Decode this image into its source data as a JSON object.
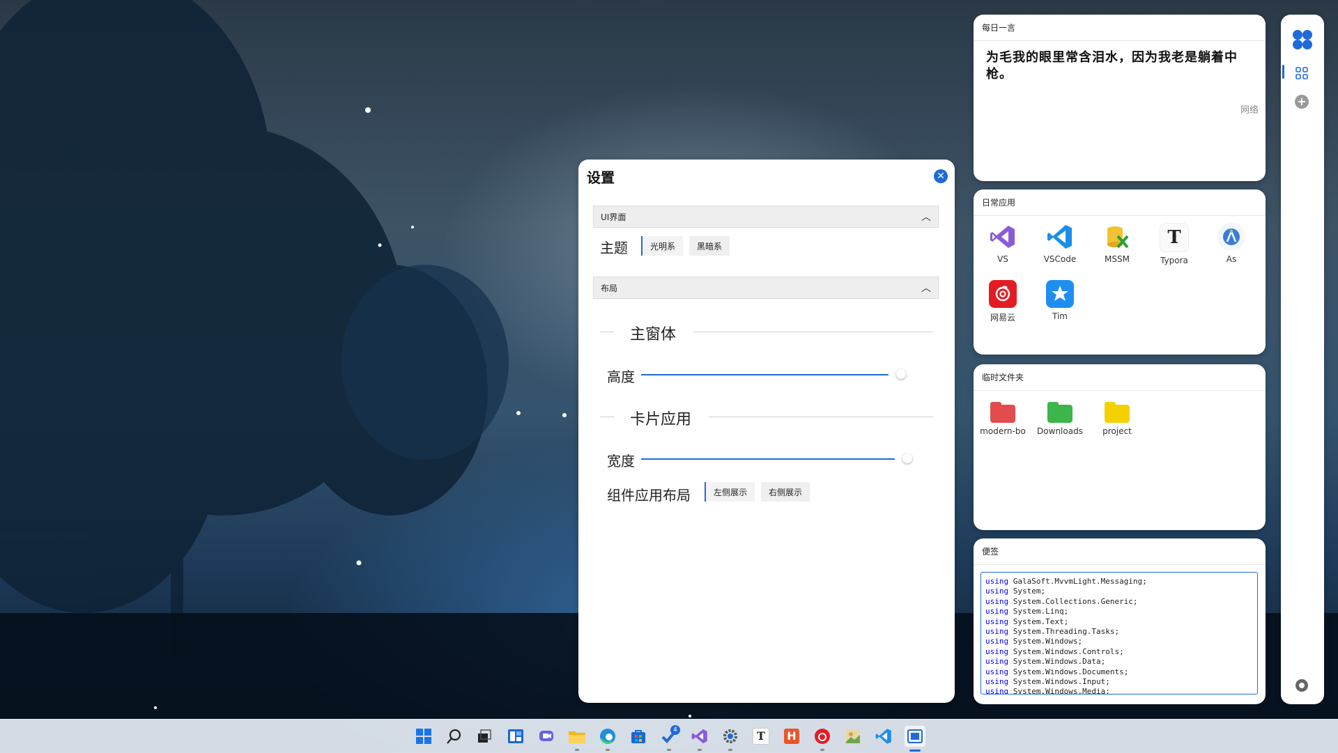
{
  "settings": {
    "title": "设置",
    "ui_section": "UI界面",
    "theme_label": "主题",
    "theme_options": [
      "光明系",
      "黑暗系"
    ],
    "layout_section": "布局",
    "main_window_title": "主窗体",
    "height_label": "高度",
    "height_value_pct": 97,
    "card_app_title": "卡片应用",
    "width_label": "宽度",
    "width_value_pct": 98,
    "component_layout_label": "组件应用布局",
    "layout_options": [
      "左侧展示",
      "右侧展示"
    ]
  },
  "quote_card": {
    "header": "每日一言",
    "text": "为毛我的眼里常含泪水，因为我老是躺着中枪。",
    "source": "网络"
  },
  "apps_card": {
    "header": "日常应用",
    "apps": [
      {
        "label": "VS",
        "icon": "visual-studio-icon"
      },
      {
        "label": "VSCode",
        "icon": "vscode-icon"
      },
      {
        "label": "MSSM",
        "icon": "mssm-icon"
      },
      {
        "label": "Typora",
        "icon": "typora-icon"
      },
      {
        "label": "As",
        "icon": "android-studio-icon"
      },
      {
        "label": "网易云",
        "icon": "netease-music-icon"
      },
      {
        "label": "Tim",
        "icon": "tim-icon"
      }
    ]
  },
  "folder_card": {
    "header": "临时文件夹",
    "folders": [
      {
        "label": "modern-bo",
        "color": "#e24c4c"
      },
      {
        "label": "Downloads",
        "color": "#3cb54a"
      },
      {
        "label": "project",
        "color": "#f5d000"
      }
    ]
  },
  "notes_card": {
    "header": "便签",
    "lines": [
      {
        "kw": "using",
        "text": " GalaSoft.MvvmLight.Messaging;"
      },
      {
        "kw": "using",
        "text": " System;"
      },
      {
        "kw": "using",
        "text": " System.Collections.Generic;"
      },
      {
        "kw": "using",
        "text": " System.Linq;"
      },
      {
        "kw": "using",
        "text": " System.Text;"
      },
      {
        "kw": "using",
        "text": " System.Threading.Tasks;"
      },
      {
        "kw": "using",
        "text": " System.Windows;"
      },
      {
        "kw": "using",
        "text": " System.Windows.Controls;"
      },
      {
        "kw": "using",
        "text": " System.Windows.Data;"
      },
      {
        "kw": "using",
        "text": " System.Windows.Documents;"
      },
      {
        "kw": "using",
        "text": " System.Windows.Input;"
      },
      {
        "kw": "using",
        "text": " System.Windows.Media;"
      }
    ]
  },
  "taskbar": {
    "badge_count": "4",
    "icons": [
      "start-icon",
      "search-icon",
      "task-view-icon",
      "widgets-icon",
      "teams-chat-icon",
      "file-explorer-icon",
      "edge-icon",
      "store-icon",
      "todo-icon",
      "visual-studio-icon",
      "settings-icon",
      "typora-icon",
      "hbuilder-icon",
      "netease-music-icon",
      "photo-app-icon",
      "vscode-icon",
      "active-app-icon"
    ]
  },
  "colors": {
    "accent": "#1f6ad8"
  }
}
